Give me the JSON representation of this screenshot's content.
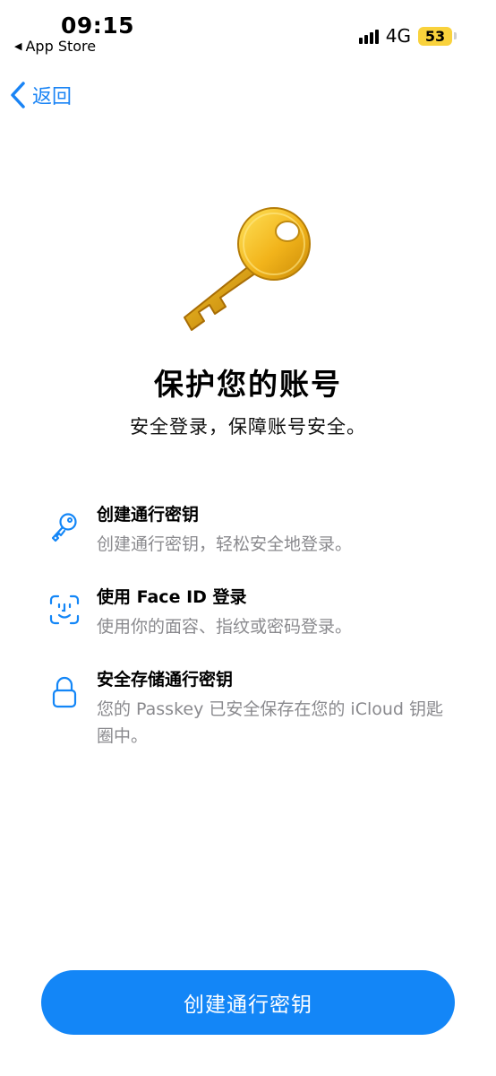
{
  "status_bar": {
    "time": "09:15",
    "back_app": "App Store",
    "network": "4G",
    "battery": "53"
  },
  "nav": {
    "back_label": "返回"
  },
  "hero": {
    "title": "保护您的账号",
    "subtitle": "安全登录，保障账号安全。"
  },
  "features": [
    {
      "icon": "key-icon",
      "title": "创建通行密钥",
      "desc": "创建通行密钥，轻松安全地登录。"
    },
    {
      "icon": "face-id-icon",
      "title": "使用 Face ID 登录",
      "desc": "使用你的面容、指纹或密码登录。"
    },
    {
      "icon": "lock-icon",
      "title": "安全存储通行密钥",
      "desc": "您的 Passkey 已安全保存在您的 iCloud 钥匙圈中。"
    }
  ],
  "primary_button": "创建通行密钥",
  "colors": {
    "accent": "#1386f7",
    "battery": "#f9d23c",
    "secondary_text": "#8a8a8e"
  }
}
